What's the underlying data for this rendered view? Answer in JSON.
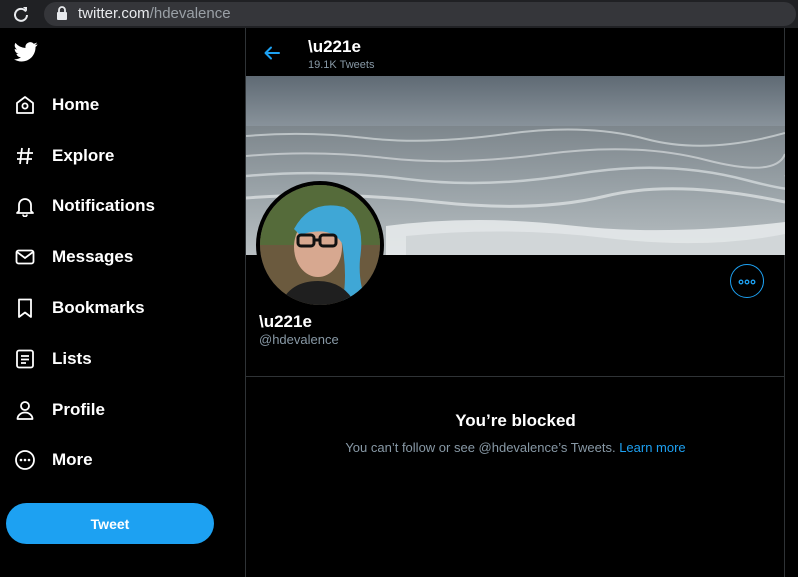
{
  "browser": {
    "url_host": "twitter.com",
    "url_path": "/hdevalence"
  },
  "nav": {
    "items": [
      {
        "label": "Home",
        "icon": "home-icon"
      },
      {
        "label": "Explore",
        "icon": "hashtag-icon"
      },
      {
        "label": "Notifications",
        "icon": "bell-icon"
      },
      {
        "label": "Messages",
        "icon": "envelope-icon"
      },
      {
        "label": "Bookmarks",
        "icon": "bookmark-icon"
      },
      {
        "label": "Lists",
        "icon": "list-icon"
      },
      {
        "label": "Profile",
        "icon": "person-icon"
      },
      {
        "label": "More",
        "icon": "more-circle-icon"
      }
    ],
    "tweet_label": "Tweet"
  },
  "header": {
    "name": "\\u221e",
    "tweet_count": "19.1K Tweets"
  },
  "profile": {
    "name": "\\u221e",
    "handle": "@hdevalence"
  },
  "blocked": {
    "title": "You’re blocked",
    "message": "You can’t follow or see @hdevalence’s Tweets.",
    "link": "Learn more"
  },
  "colors": {
    "accent": "#1da1f2",
    "background": "#000000",
    "secondary_text": "#8899a6",
    "border": "#2f3336"
  }
}
